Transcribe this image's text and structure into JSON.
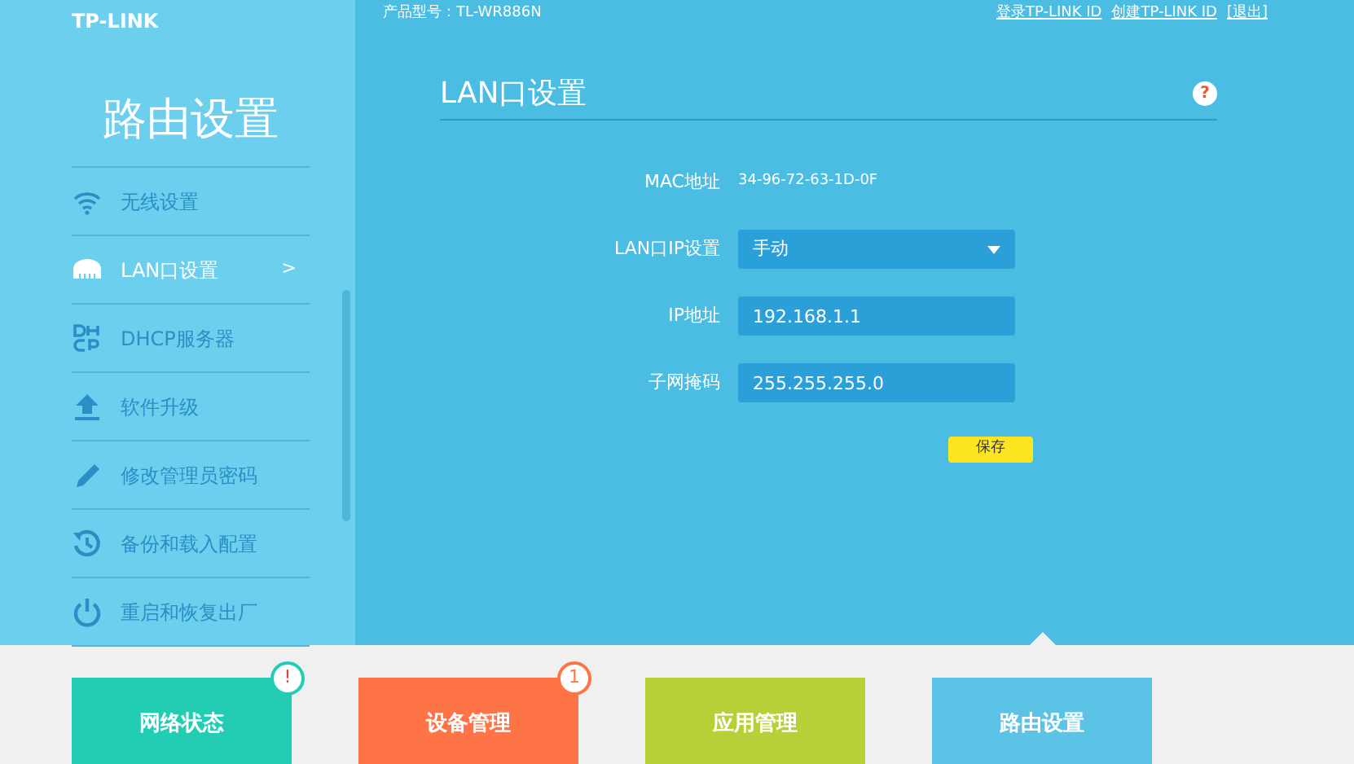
{
  "header": {
    "logo": "TP-LINK",
    "model": "产品型号：TL-WR886N",
    "links": [
      "登录TP-LINK ID",
      "创建TP-LINK ID",
      "[退出]"
    ]
  },
  "sidebar": {
    "title": "路由设置",
    "items": [
      {
        "label": "无线设置",
        "kind": "wifi",
        "selected": false
      },
      {
        "label": "LAN口设置",
        "kind": "lan",
        "selected": true,
        "arrow": ">"
      },
      {
        "label": "DHCP服务器",
        "kind": "dhcp",
        "selected": false
      },
      {
        "label": "软件升级",
        "kind": "upload",
        "selected": false
      },
      {
        "label": "修改管理员密码",
        "kind": "pencil",
        "selected": false
      },
      {
        "label": "备份和载入配置",
        "kind": "history",
        "selected": false
      },
      {
        "label": "重启和恢复出厂",
        "kind": "power",
        "selected": false
      }
    ]
  },
  "panel": {
    "title": "LAN口设置",
    "help": "?",
    "fields": [
      {
        "kind": "static",
        "label": "MAC地址",
        "value": "34-96-72-63-1D-0F"
      },
      {
        "kind": "select",
        "label": "LAN口IP设置",
        "value": "手动"
      },
      {
        "kind": "input",
        "label": "IP地址",
        "value": "192.168.1.1"
      },
      {
        "kind": "input",
        "label": "子网掩码",
        "value": "255.255.255.0"
      }
    ],
    "save": "保存"
  },
  "tiles": [
    {
      "label": "网络状态",
      "color": "#22cdb4",
      "badge": "!",
      "selected": false
    },
    {
      "label": "设备管理",
      "color": "#ff7446",
      "badge": "1",
      "selected": false
    },
    {
      "label": "应用管理",
      "color": "#b5d137",
      "selected": false
    },
    {
      "label": "路由设置",
      "color": "#5ac3e6",
      "selected": true
    }
  ]
}
